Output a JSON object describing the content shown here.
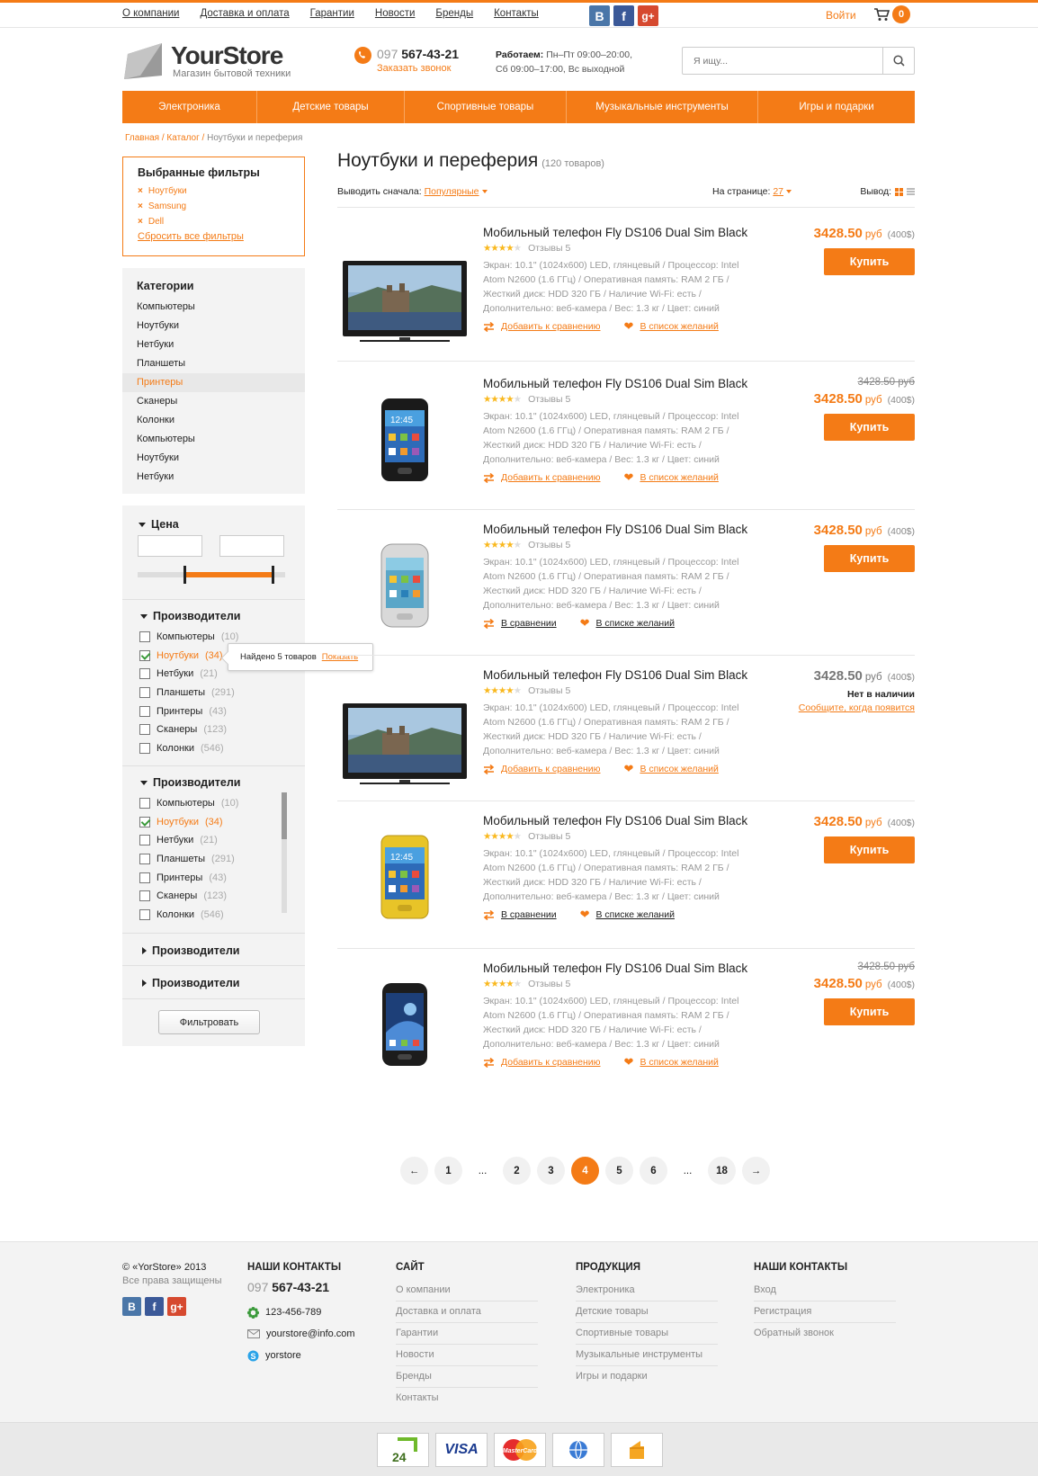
{
  "topnav": [
    "О компании",
    "Доставка и оплата",
    "Гарантии",
    "Новости",
    "Бренды",
    "Контакты"
  ],
  "social": {
    "vk": "В",
    "fb": "f",
    "gp": "g+"
  },
  "login": "Войти",
  "cart_count": "0",
  "logo": {
    "name": "YourStore",
    "tagline": "Магазин бытовой техники"
  },
  "phone": {
    "code": "097",
    "number": "567-43-21",
    "callback": "Заказать звонок"
  },
  "hours": {
    "label": "Работаем:",
    "line1": "Пн–Пт 09:00–20:00,",
    "line2": "Сб 09:00–17:00, Вс выходной"
  },
  "search": {
    "placeholder": "Я ищу..."
  },
  "mainnav": [
    "Электроника",
    "Детские товары",
    "Спортивные товары",
    "Музыкальные инструменты",
    "Игры и подарки"
  ],
  "breadcrumbs": {
    "home": "Главная",
    "catalog": "Каталог",
    "current": "Ноутбуки и переферия"
  },
  "selected_filters": {
    "title": "Выбранные фильтры",
    "items": [
      "Ноутбуки",
      "Samsung",
      "Dell"
    ],
    "reset": "Сбросить все фильтры",
    "remove_glyph": "×"
  },
  "categories": {
    "title": "Категории",
    "items": [
      "Компьютеры",
      "Ноутбуки",
      "Нетбуки",
      "Планшеты",
      "Принтеры",
      "Сканеры",
      "Колонки",
      "Компьютеры",
      "Ноутбуки",
      "Нетбуки"
    ],
    "active": "Принтеры"
  },
  "price_filter": {
    "title": "Цена"
  },
  "manufacturers": {
    "title": "Производители",
    "items": [
      {
        "name": "Компьютеры",
        "count": "(10)",
        "checked": false
      },
      {
        "name": "Ноутбуки",
        "count": "(34)",
        "checked": true
      },
      {
        "name": "Нетбуки",
        "count": "(21)",
        "checked": false
      },
      {
        "name": "Планшеты",
        "count": "(291)",
        "checked": false
      },
      {
        "name": "Принтеры",
        "count": "(43)",
        "checked": false
      },
      {
        "name": "Сканеры",
        "count": "(123)",
        "checked": false
      },
      {
        "name": "Колонки",
        "count": "(546)",
        "checked": false
      }
    ]
  },
  "tooltip": {
    "text": "Найдено 5 товаров",
    "link": "Показать"
  },
  "collapsed_filters": [
    "Производители",
    "Производители"
  ],
  "filter_button": "Фильтровать",
  "catalog": {
    "title": "Ноутбуки и переферия",
    "count": "(120 товаров)"
  },
  "sort": {
    "label": "Выводить сначала:",
    "value": "Популярные",
    "per_page_label": "На странице:",
    "per_page": "27",
    "view_label": "Вывод:"
  },
  "products": [
    {
      "name": "Мобильный телефон Fly DS106 Dual Sim Black",
      "reviews": "Отзывы 5",
      "desc": "Экран: 10.1\" (1024x600) LED, глянцевый / Процессор: Intel Atom N2600 (1.6 ГГц) /  Оперативная память: RAM 2 ГБ / Жесткий диск: HDD 320 ГБ / Наличие Wi-Fi: есть / Дополнительно: веб-камера / Вес: 1.3 кг / Цвет: синий",
      "old_price": "",
      "price": "3428.50",
      "currency": "руб",
      "usd": "(400$)",
      "buy": "Купить",
      "compare": "Добавить к сравнению",
      "wish": "В список желаний",
      "image": "tv",
      "stock": "in"
    },
    {
      "name": "Мобильный телефон Fly DS106 Dual Sim Black",
      "reviews": "Отзывы 5",
      "desc": "Экран: 10.1\" (1024x600) LED, глянцевый / Процессор: Intel Atom N2600 (1.6 ГГц) /  Оперативная память: RAM 2 ГБ / Жесткий диск: HDD 320 ГБ / Наличие Wi-Fi: есть / Дополнительно: веб-камера / Вес: 1.3 кг / Цвет: синий",
      "old_price": "3428.50 руб",
      "price": "3428.50",
      "currency": "руб",
      "usd": "(400$)",
      "buy": "Купить",
      "compare": "Добавить к сравнению",
      "wish": "В список желаний",
      "image": "phone-black",
      "stock": "in"
    },
    {
      "name": "Мобильный телефон Fly DS106 Dual Sim Black",
      "reviews": "Отзывы 5",
      "desc": "Экран: 10.1\" (1024x600) LED, глянцевый / Процессор: Intel Atom N2600 (1.6 ГГц) /  Оперативная память: RAM 2 ГБ / Жесткий диск: HDD 320 ГБ / Наличие Wi-Fi: есть / Дополнительно: веб-камера / Вес: 1.3 кг / Цвет: синий",
      "old_price": "",
      "price": "3428.50",
      "currency": "руб",
      "usd": "(400$)",
      "buy": "Купить",
      "compare": "В сравнении",
      "wish": "В списке желаний",
      "image": "phone-white",
      "stock": "in"
    },
    {
      "name": "Мобильный телефон Fly DS106 Dual Sim Black",
      "reviews": "Отзывы 5",
      "desc": "Экран: 10.1\" (1024x600) LED, глянцевый / Процессор: Intel Atom N2600 (1.6 ГГц) /  Оперативная память: RAM 2 ГБ / Жесткий диск: HDD 320 ГБ / Наличие Wi-Fi: есть / Дополнительно: веб-камера / Вес: 1.3 кг / Цвет: синий",
      "old_price": "",
      "price": "3428.50",
      "currency": "руб",
      "usd": "(400$)",
      "buy": "",
      "compare": "Добавить к сравнению",
      "wish": "В список желаний",
      "image": "tv",
      "stock": "out",
      "out_text": "Нет в наличии",
      "notify": "Сообщите, когда появится"
    },
    {
      "name": "Мобильный телефон Fly DS106 Dual Sim Black",
      "reviews": "Отзывы 5",
      "desc": "Экран: 10.1\" (1024x600) LED, глянцевый / Процессор: Intel Atom N2600 (1.6 ГГц) /  Оперативная память: RAM 2 ГБ / Жесткий диск: HDD 320 ГБ / Наличие Wi-Fi: есть / Дополнительно: веб-камера / Вес: 1.3 кг / Цвет: синий",
      "old_price": "",
      "price": "3428.50",
      "currency": "руб",
      "usd": "(400$)",
      "buy": "Купить",
      "compare": "В сравнении",
      "wish": "В списке желаний",
      "image": "phone-yellow",
      "stock": "in"
    },
    {
      "name": "Мобильный телефон Fly DS106 Dual Sim Black",
      "reviews": "Отзывы 5",
      "desc": "Экран: 10.1\" (1024x600) LED, глянцевый / Процессор: Intel Atom N2600 (1.6 ГГц) /  Оперативная память: RAM 2 ГБ / Жесткий диск: HDD 320 ГБ / Наличие Wi-Fi: есть / Дополнительно: веб-камера / Вес: 1.3 кг / Цвет: синий",
      "old_price": "3428.50 руб",
      "price": "3428.50",
      "currency": "руб",
      "usd": "(400$)",
      "buy": "Купить",
      "compare": "Добавить к сравнению",
      "wish": "В список желаний",
      "image": "phone-galaxy",
      "stock": "in"
    }
  ],
  "rating": {
    "filled": 4,
    "max": 5
  },
  "pagination": {
    "prev": "←",
    "pages": [
      "1",
      "...",
      "2",
      "3",
      "4",
      "5",
      "6",
      "...",
      "18"
    ],
    "current": "4",
    "next": "→"
  },
  "footer": {
    "copyright": "© «YorStore» 2013",
    "rights": "Все права защищены",
    "contacts": {
      "title": "НАШИ КОНТАКТЫ",
      "phone_code": "097",
      "phone": "567-43-21",
      "icq": "123-456-789",
      "email": "yourstore@info.com",
      "skype": "yorstore"
    },
    "site": {
      "title": "САЙТ",
      "items": [
        "О компании",
        "Доставка и оплата",
        "Гарантии",
        "Новости",
        "Бренды",
        "Контакты"
      ]
    },
    "products": {
      "title": "ПРОДУКЦИЯ",
      "items": [
        "Электроника",
        "Детские товары",
        "Спортивные товары",
        "Музыкальные инструменты",
        "Игры и подарки"
      ]
    },
    "account": {
      "title": "НАШИ КОНТАКТЫ",
      "items": [
        "Вход",
        "Регистрация",
        "Обратный звонок"
      ]
    }
  },
  "payments": [
    "privat24",
    "visa",
    "mastercard",
    "webmoney",
    "yandex-money"
  ],
  "payment_labels": {
    "privat24": "24",
    "visa": "VISA",
    "mastercard": "MasterCard"
  },
  "colors": {
    "accent": "#f47b16",
    "vk": "#4a76a8",
    "facebook": "#3b5998",
    "gplus": "#d6492f"
  }
}
